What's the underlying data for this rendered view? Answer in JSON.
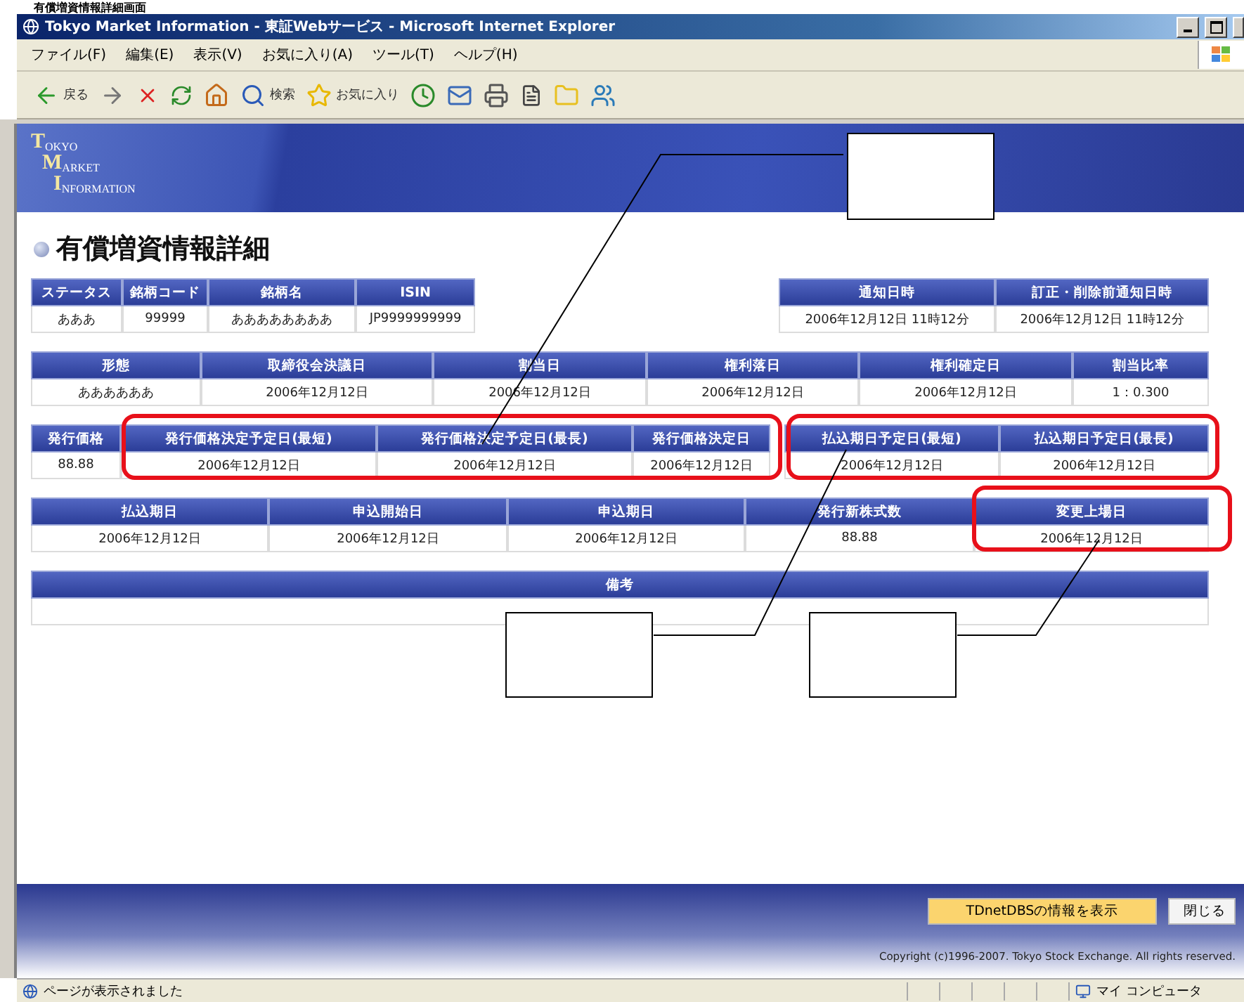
{
  "document_heading": "有償増資情報詳細画面",
  "window": {
    "title": "Tokyo Market Information - 東証Webサービス - Microsoft Internet Explorer"
  },
  "menu": [
    "ファイル(F)",
    "編集(E)",
    "表示(V)",
    "お気に入り(A)",
    "ツール(T)",
    "ヘルプ(H)"
  ],
  "toolbar": [
    {
      "kind": "back",
      "label": "戻る"
    },
    {
      "kind": "forward"
    },
    {
      "kind": "stop"
    },
    {
      "kind": "refresh"
    },
    {
      "kind": "home"
    },
    {
      "kind": "search",
      "label": "検索"
    },
    {
      "kind": "favorites",
      "label": "お気に入り"
    },
    {
      "kind": "history"
    },
    {
      "kind": "mail"
    },
    {
      "kind": "print"
    },
    {
      "kind": "edit"
    },
    {
      "kind": "folder"
    },
    {
      "kind": "messenger"
    }
  ],
  "logo": [
    {
      "initial": "T",
      "rest": "OKYO"
    },
    {
      "initial": "M",
      "rest": "ARKET"
    },
    {
      "initial": "I",
      "rest": "NFORMATION"
    }
  ],
  "page_title": "有償増資情報詳細",
  "sections": [
    {
      "groups": [
        {
          "columns": [
            {
              "header": "ステータス",
              "value": "あああ"
            },
            {
              "header": "銘柄コード",
              "value": "99999"
            },
            {
              "header": "銘柄名",
              "value": "ああああああああ"
            },
            {
              "header": "ISIN",
              "value": "JP9999999999"
            }
          ]
        },
        {
          "columns": [
            {
              "header": "通知日時",
              "value": "2006年12月12日 11時12分"
            },
            {
              "header": "訂正・削除前通知日時",
              "value": "2006年12月12日 11時12分"
            }
          ]
        }
      ]
    },
    {
      "groups": [
        {
          "columns": [
            {
              "header": "形態",
              "value": "ああああああ"
            },
            {
              "header": "取締役会決議日",
              "value": "2006年12月12日"
            },
            {
              "header": "割当日",
              "value": "2006年12月12日"
            },
            {
              "header": "権利落日",
              "value": "2006年12月12日"
            },
            {
              "header": "権利確定日",
              "value": "2006年12月12日"
            },
            {
              "header": "割当比率",
              "value": "1：0.300"
            }
          ]
        }
      ]
    },
    {
      "groups": [
        {
          "columns": [
            {
              "header": "発行価格",
              "value": "88.88"
            },
            {
              "header": "発行価格決定予定日(最短)",
              "value": "2006年12月12日"
            },
            {
              "header": "発行価格決定予定日(最長)",
              "value": "2006年12月12日"
            },
            {
              "header": "発行価格決定日",
              "value": "2006年12月12日"
            }
          ]
        },
        {
          "columns": [
            {
              "header": "払込期日予定日(最短)",
              "value": "2006年12月12日"
            },
            {
              "header": "払込期日予定日(最長)",
              "value": "2006年12月12日"
            }
          ]
        }
      ]
    },
    {
      "groups": [
        {
          "columns": [
            {
              "header": "払込期日",
              "value": "2006年12月12日"
            },
            {
              "header": "申込開始日",
              "value": "2006年12月12日"
            },
            {
              "header": "申込期日",
              "value": "2006年12月12日"
            },
            {
              "header": "発行新株式数",
              "value": "88.88"
            },
            {
              "header": "変更上場日",
              "value": "2006年12月12日"
            }
          ]
        }
      ]
    },
    {
      "groups": [
        {
          "columns": [
            {
              "header": "備考"
            }
          ]
        }
      ]
    }
  ],
  "buttons": [
    {
      "label": "TDnetDBSの情報を表示",
      "kind": "primary"
    },
    {
      "label": "閉じる",
      "kind": "plain"
    }
  ],
  "copyright": "Copyright (c)1996-2007. Tokyo Stock Exchange. All rights reserved.",
  "status_bar": {
    "message": "ページが表示されました",
    "zone": "マイ コンピュータ"
  }
}
